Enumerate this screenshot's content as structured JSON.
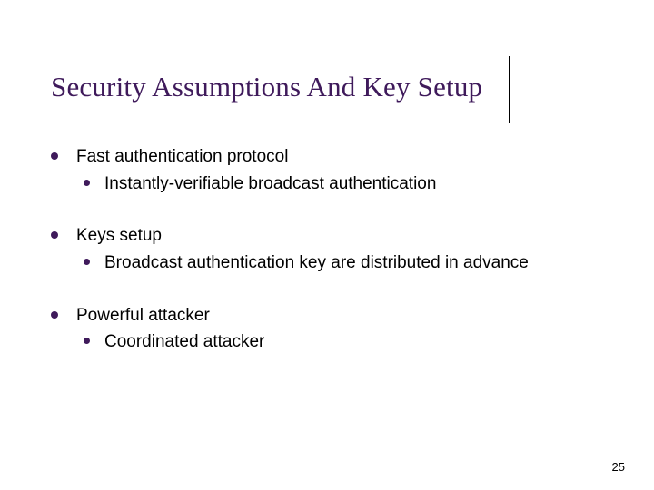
{
  "title": "Security Assumptions And Key Setup",
  "bullets": [
    {
      "text": "Fast authentication protocol",
      "sub": [
        {
          "text": "Instantly-verifiable broadcast authentication"
        }
      ]
    },
    {
      "text": "Keys setup",
      "sub": [
        {
          "text": "Broadcast authentication key are distributed in advance"
        }
      ]
    },
    {
      "text": "Powerful attacker",
      "sub": [
        {
          "text": "Coordinated attacker"
        }
      ]
    }
  ],
  "page_number": "25"
}
